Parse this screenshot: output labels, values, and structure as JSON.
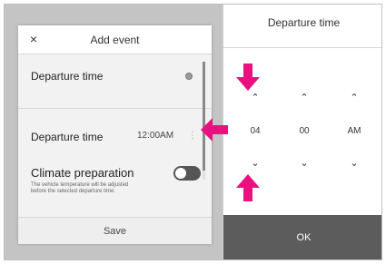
{
  "left_panel": {
    "close_glyph": "×",
    "title": "Add event",
    "rows": {
      "departure_time_label": "Departure time",
      "departure_time_setting_label": "Departure time",
      "departure_time_value": "12:00AM",
      "departure_time_more": "⋮",
      "climate_label": "Climate preparation",
      "climate_description": "The vehicle temperature will be adjusted before the selected departure time."
    },
    "save_label": "Save"
  },
  "right_panel": {
    "title": "Departure time",
    "columns": [
      {
        "value": "04"
      },
      {
        "value": "00"
      },
      {
        "value": "AM"
      }
    ],
    "chevron_up": "⌃",
    "chevron_down": "⌄",
    "ok_label": "OK"
  },
  "colors": {
    "annotation_arrow": "#e8117f",
    "ok_background": "#5c5c5c",
    "toggle_off": "#555555"
  }
}
